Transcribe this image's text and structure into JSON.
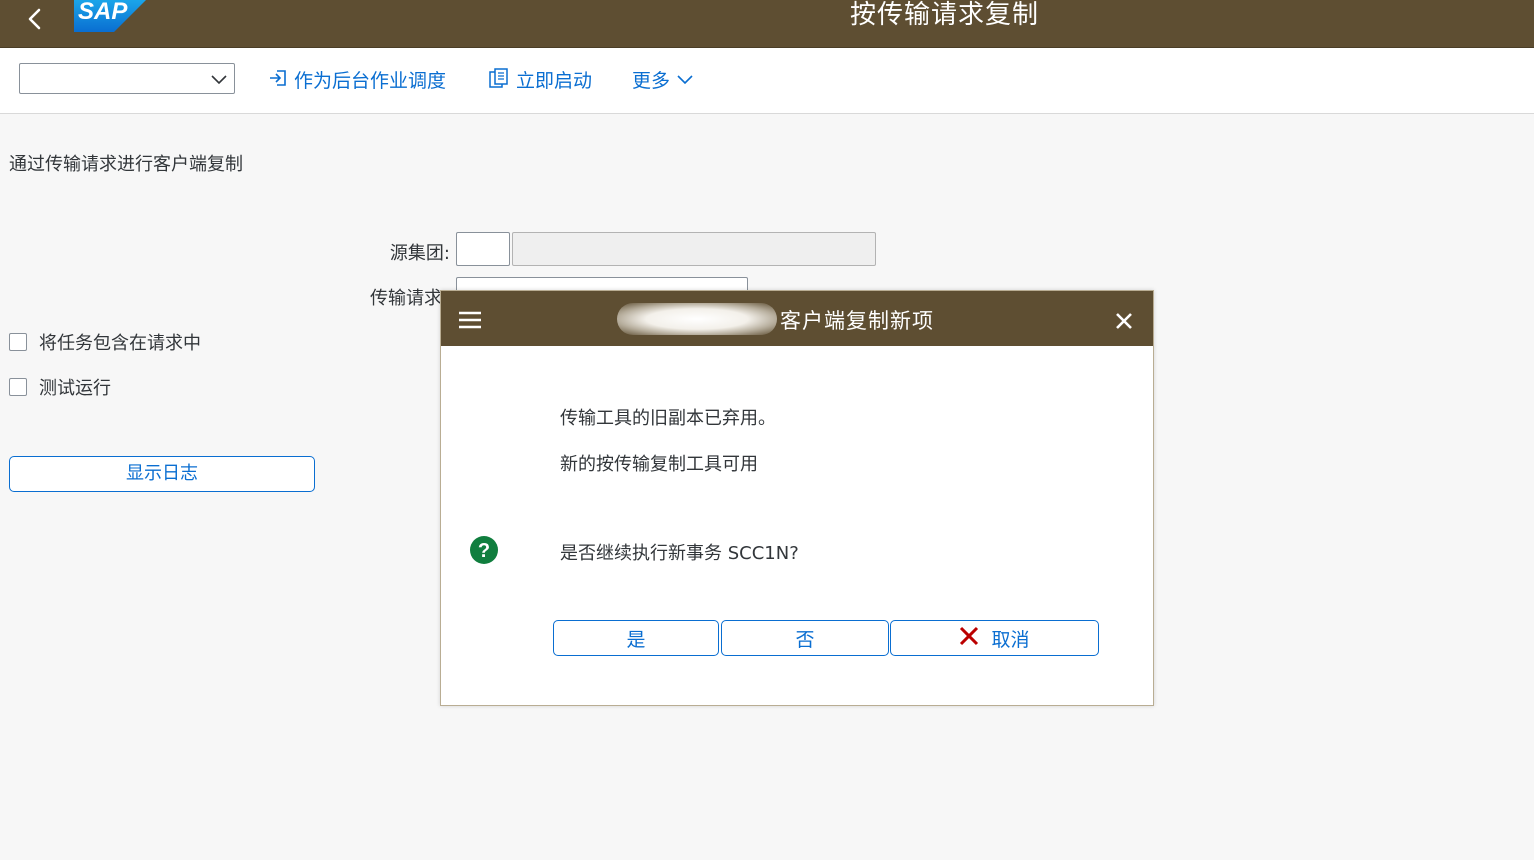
{
  "shell": {
    "title": "按传输请求复制",
    "logo_text": "SAP"
  },
  "toolbar": {
    "select_value": "",
    "schedule_label": "作为后台作业调度",
    "start_label": "立即启动",
    "more_label": "更多"
  },
  "page": {
    "title": "通过传输请求进行客户端复制",
    "source_client_label": "源集团:",
    "source_client_value": "",
    "source_client_desc": "",
    "transport_request_label": "传输请求",
    "include_tasks_label": "将任务包含在请求中",
    "test_run_label": "测试运行",
    "show_log_label": "显示日志"
  },
  "dialog": {
    "title": "客户端复制新项",
    "message_line1": "传输工具的旧副本已弃用。",
    "message_line2": "新的按传输复制工具可用",
    "question": "是否继续执行新事务 SCC1N?",
    "yes_label": "是",
    "no_label": "否",
    "cancel_label": "取消"
  },
  "colors": {
    "shell_bg": "#5e4e32",
    "accent": "#0a6ed1",
    "question_icon": "#107e3e",
    "cancel_icon": "#bb0000"
  }
}
